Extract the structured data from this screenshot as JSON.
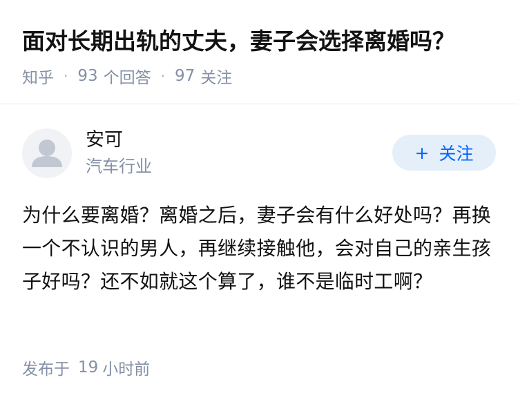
{
  "question": {
    "title": "面对长期出轨的丈夫，妻子会选择离婚吗？",
    "source": "知乎",
    "answer_count": "93",
    "answer_label": "个回答",
    "follow_count": "97",
    "follow_label": "关注",
    "separator": "·"
  },
  "author": {
    "name": "安可",
    "bio": "汽车行业",
    "avatar_icon": "default-avatar-icon",
    "follow_button": {
      "plus": "+",
      "label": "关注"
    }
  },
  "answer": {
    "text": "为什么要离婚？离婚之后，妻子会有什么好处吗？再换一个不认识的男人，再继续接触他，会对自己的亲生孩子好吗？还不如就这个算了，谁不是临时工啊？",
    "posted_prefix": "发布于",
    "posted_value": "19",
    "posted_unit": "小时前"
  },
  "colors": {
    "title": "#121212",
    "meta": "#8590a6",
    "accent": "#0066ff",
    "follow_bg": "#e5effa",
    "avatar_bg": "#f0f2f5",
    "avatar_fg": "#c2c8d2"
  }
}
